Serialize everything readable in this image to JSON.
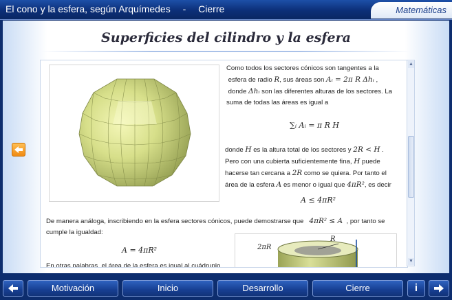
{
  "header": {
    "title_parts": [
      "El cono y la esfera, según Arquímedes",
      "-",
      "Cierre"
    ],
    "subject": "Matemáticas"
  },
  "page": {
    "heading": "Superficies del cilindro y la esfera"
  },
  "content": {
    "p1_line1": "Como todos los sectores cónicos son tangentes a la",
    "p1_line2a": "esfera de radio",
    "p1_line2b": ", sus áreas son",
    "p1_line3a": "donde",
    "p1_line3b": "son las diferentes alturas de los sectores. La",
    "p1_line4": "suma de todas las áreas es igual a",
    "p2_line1a": "donde",
    "p2_line1b": "es la altura total de los sectores y",
    "p2_line2a": "Pero con una cubierta suficientemente fina,",
    "p2_line2b": "puede",
    "p2_line3a": "hacerse tan cercana a",
    "p2_line3b": "como se quiera. Por tanto el",
    "p2_line4a": "área de la esfera",
    "p2_line4b": "es menor o igual que",
    "p2_line4c": ", es decir",
    "p3_line1a": "De manera análoga, inscribiendo en la esfera sectores cónicos, puede demostrarse que",
    "p3_line1b": ", por tanto se",
    "p3_line2": "cumple la igualdad:",
    "p4_line1": "En otras palabras, el área de la esfera es igual al cuádruplo",
    "sym_R": "R",
    "sym_Ai": "Aᵢ = 2π R Δhᵢ",
    "sym_dhi": "Δhᵢ",
    "sym_H": "H",
    "sym_2RltH": "2R < H",
    "sym_2R": "2R",
    "sym_A": "A",
    "sym_4piR2": "4πR²",
    "formula_sum": "∑ᵢ Aᵢ = π R H",
    "formula_le": "A ≤ 4πR²",
    "formula_ge": "4πR² ≤ A",
    "formula_eq": "A = 4πR²",
    "cyl_label_2piR": "2πR",
    "cyl_label_R": "R"
  },
  "nav": {
    "prev_label": "⬅",
    "buttons": [
      "Motivación",
      "Inicio",
      "Desarrollo",
      "Cierre"
    ],
    "info_label": "i",
    "next_label": "➡",
    "side_back": "⬅"
  },
  "scroll": {
    "up": "▲",
    "down": "▼"
  }
}
